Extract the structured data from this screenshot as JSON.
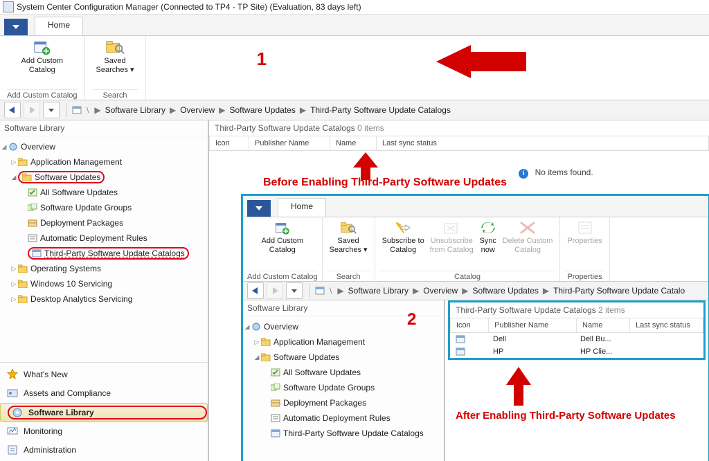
{
  "window": {
    "title": "System Center Configuration Manager (Connected to TP4 - TP Site) (Evaluation, 83 days left)"
  },
  "mainTabs": {
    "home": "Home"
  },
  "ribbon": {
    "addCustomCatalog": "Add Custom\nCatalog",
    "addCustomCatalogGroup": "Add Custom Catalog",
    "savedSearches": "Saved\nSearches ▾",
    "searchGroup": "Search"
  },
  "breadcrumb": [
    "Software Library",
    "Overview",
    "Software Updates",
    "Third-Party Software Update Catalogs"
  ],
  "navPaneTitle": "Software Library",
  "tree": {
    "overview": "Overview",
    "appMgmt": "Application Management",
    "softUpd": "Software Updates",
    "allSU": "All Software Updates",
    "suGroups": "Software Update Groups",
    "depPkg": "Deployment Packages",
    "adr": "Automatic Deployment Rules",
    "tpsuc": "Third-Party Software Update Catalogs",
    "os": "Operating Systems",
    "win10": "Windows 10 Servicing",
    "desktop": "Desktop Analytics Servicing"
  },
  "wunderbar": {
    "whatsNew": "What's New",
    "assets": "Assets and Compliance",
    "softlib": "Software Library",
    "monitoring": "Monitoring",
    "admin": "Administration"
  },
  "listBefore": {
    "title": "Third-Party Software Update Catalogs",
    "count": "0 items",
    "cols": {
      "icon": "Icon",
      "pub": "Publisher Name",
      "name": "Name",
      "sync": "Last sync status"
    },
    "noItems": "No items found."
  },
  "annot": {
    "one": "1",
    "before": "Before Enabling Third-Party Software Updates",
    "two": "2",
    "after": "After Enabling Third-Party Software Updates"
  },
  "inset": {
    "ribbon": {
      "addCustomCatalog": "Add Custom\nCatalog",
      "addCustomCatalogGroup": "Add Custom Catalog",
      "savedSearches": "Saved\nSearches ▾",
      "searchGroup": "Search",
      "subscribe": "Subscribe to\nCatalog",
      "unsubscribe": "Unsubscribe\nfrom Catalog",
      "syncNow": "Sync\nnow",
      "deleteCustom": "Delete Custom\nCatalog",
      "catalogGroup": "Catalog",
      "properties": "Properties",
      "propertiesGroup": "Properties"
    },
    "breadcrumb": [
      "Software Library",
      "Overview",
      "Software Updates",
      "Third-Party Software Update Catalo"
    ],
    "listAfter": {
      "title": "Third-Party Software Update Catalogs",
      "count": "2 items",
      "cols": {
        "icon": "Icon",
        "pub": "Publisher Name",
        "name": "Name",
        "sync": "Last sync status"
      },
      "rows": [
        {
          "pub": "Dell",
          "name": "Dell Bu..."
        },
        {
          "pub": "HP",
          "name": "HP Clie..."
        }
      ]
    }
  }
}
